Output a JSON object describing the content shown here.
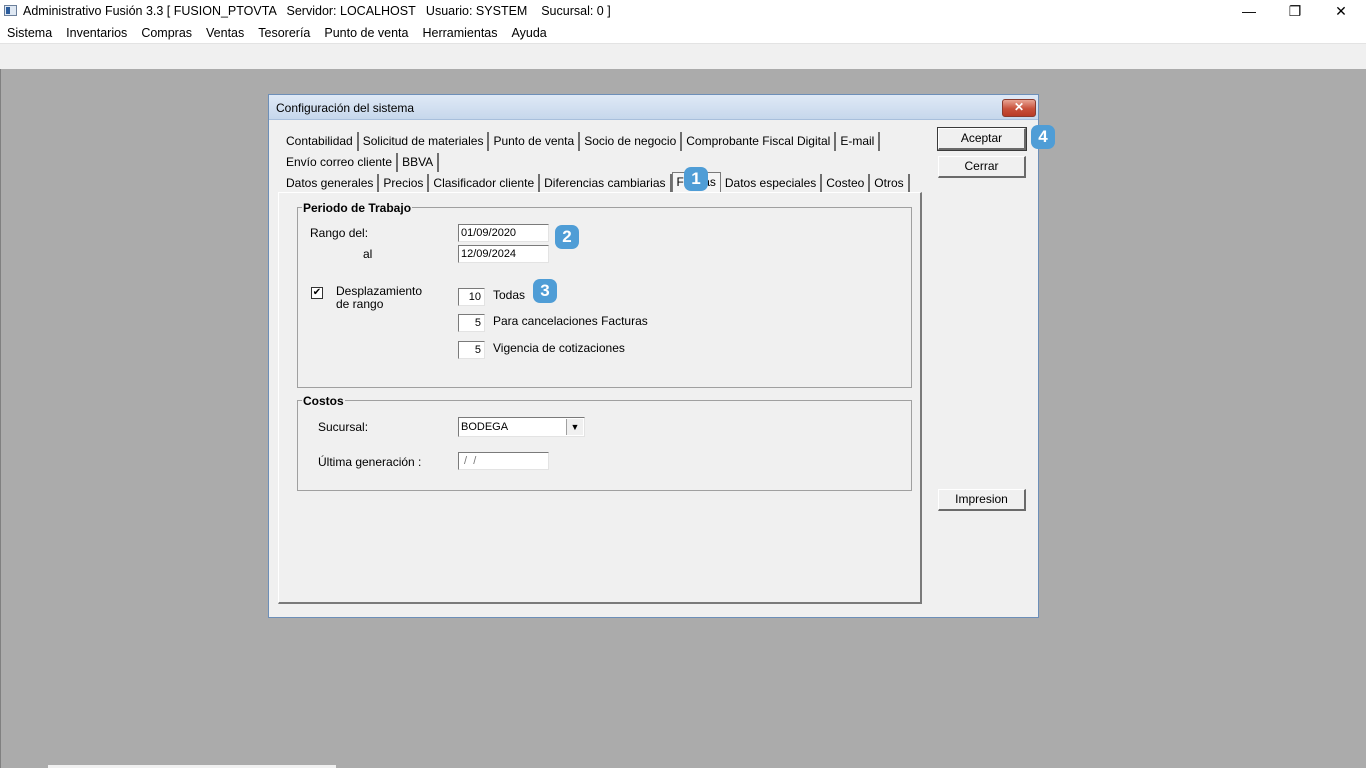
{
  "window": {
    "title": "Administrativo Fusión 3.3 [ FUSION_PTOVTA   Servidor: LOCALHOST   Usuario: SYSTEM    Sucursal: 0 ]",
    "controls": {
      "minimize": "—",
      "maximize": "❐",
      "close": "✕"
    }
  },
  "menu": [
    "Sistema",
    "Inventarios",
    "Compras",
    "Ventas",
    "Tesorería",
    "Punto de venta",
    "Herramientas",
    "Ayuda"
  ],
  "dialog": {
    "title": "Configuración del sistema",
    "close_glyph": "✕",
    "tabs_row1": [
      "Contabilidad",
      "Solicitud de materiales",
      "Punto de venta",
      "Socio de negocio",
      "Comprobante Fiscal Digital",
      "E-mail"
    ],
    "tabs_row2": [
      "Envío correo cliente",
      "BBVA"
    ],
    "tabs_row3": [
      "Datos generales",
      "Precios",
      "Clasificador cliente",
      "Diferencias cambiarias",
      "Fechas",
      "Datos especiales",
      "Costeo",
      "Otros"
    ],
    "active_tab": "Fechas",
    "periodo": {
      "legend": "Periodo de Trabajo",
      "rango_label": "Rango del:",
      "al_label": "al",
      "fecha_inicio": "01/09/2020",
      "fecha_fin": "12/09/2024",
      "desplazamiento_checked": true,
      "checkbox_mark": "✔",
      "desplazamiento_label": "Desplazamiento de rango",
      "todas_value": "10",
      "todas_label": "Todas",
      "cancelaciones_value": "5",
      "cancelaciones_label": "Para cancelaciones Facturas",
      "vigencia_value": "5",
      "vigencia_label": "Vigencia de cotizaciones"
    },
    "costos": {
      "legend": "Costos",
      "sucursal_label": "Sucursal:",
      "sucursal_value": "BODEGA",
      "dropdown_glyph": "▼",
      "ultima_label": "Última generación :",
      "ultima_value": " /  /"
    },
    "buttons": {
      "aceptar": "Aceptar",
      "cerrar": "Cerrar",
      "impresion": "Impresion"
    }
  },
  "markers": [
    "1",
    "2",
    "3",
    "4"
  ]
}
